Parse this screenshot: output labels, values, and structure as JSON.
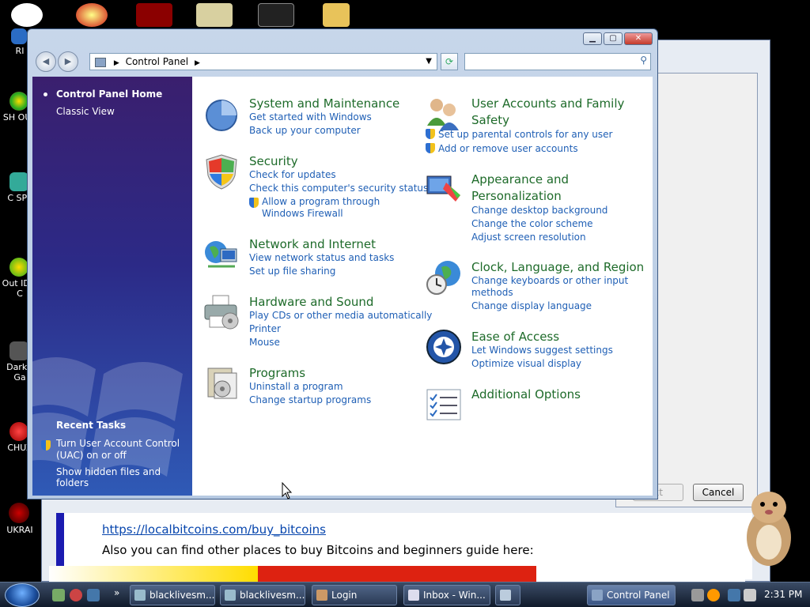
{
  "window": {
    "address": "Control Panel",
    "search_placeholder": ""
  },
  "sidebar": {
    "home": "Control Panel Home",
    "classic_view": "Classic View",
    "recent_tasks_title": "Recent Tasks",
    "recent_tasks": [
      "Turn User Account Control (UAC) on or off",
      "Show hidden files and folders"
    ]
  },
  "categories": {
    "system": {
      "title": "System and Maintenance",
      "links": [
        "Get started with Windows",
        "Back up your computer"
      ]
    },
    "security": {
      "title": "Security",
      "links": [
        "Check for updates",
        "Check this computer's security status",
        "Allow a program through Windows Firewall"
      ]
    },
    "network": {
      "title": "Network and Internet",
      "links": [
        "View network status and tasks",
        "Set up file sharing"
      ]
    },
    "hardware": {
      "title": "Hardware and Sound",
      "links": [
        "Play CDs or other media automatically",
        "Printer",
        "Mouse"
      ]
    },
    "programs": {
      "title": "Programs",
      "links": [
        "Uninstall a program",
        "Change startup programs"
      ]
    },
    "users": {
      "title_line1": "User Accounts and Family",
      "title_line2": "Safety",
      "links": [
        "Set up parental controls for any user",
        "Add or remove user accounts"
      ]
    },
    "appearance": {
      "title_line1": "Appearance and",
      "title_line2": "Personalization",
      "links": [
        "Change desktop background",
        "Change the color scheme",
        "Adjust screen resolution"
      ]
    },
    "clock": {
      "title": "Clock, Language, and Region",
      "links": [
        "Change keyboards or other input",
        "methods",
        "Change display language"
      ]
    },
    "ease": {
      "title": "Ease of Access",
      "links": [
        "Let Windows suggest settings",
        "Optimize visual display"
      ]
    },
    "additional": {
      "title": "Additional Options"
    }
  },
  "background": {
    "link": "https://localbitcoins.com/buy_bitcoins",
    "text": "Also you can find other places to buy Bitcoins and beginners guide here:",
    "cancel": "Cancel",
    "next": "xt"
  },
  "desktop_icons": [
    "RI",
    "SH OUT",
    "C SPY",
    "Out IDM C",
    "DarkC Ga",
    "CHUZ",
    "UKRAI"
  ],
  "taskbar": {
    "tasks": [
      "blacklivesm...",
      "blacklivesm...",
      "Login",
      "Inbox - Win...",
      "",
      "Control Panel"
    ],
    "clock": "2:31 PM"
  },
  "colors": {
    "category_title": "#1e6b2a",
    "link": "#1f5fb5",
    "sidebar_top": "#3a1f6e",
    "sidebar_bottom": "#2f5ab6"
  }
}
